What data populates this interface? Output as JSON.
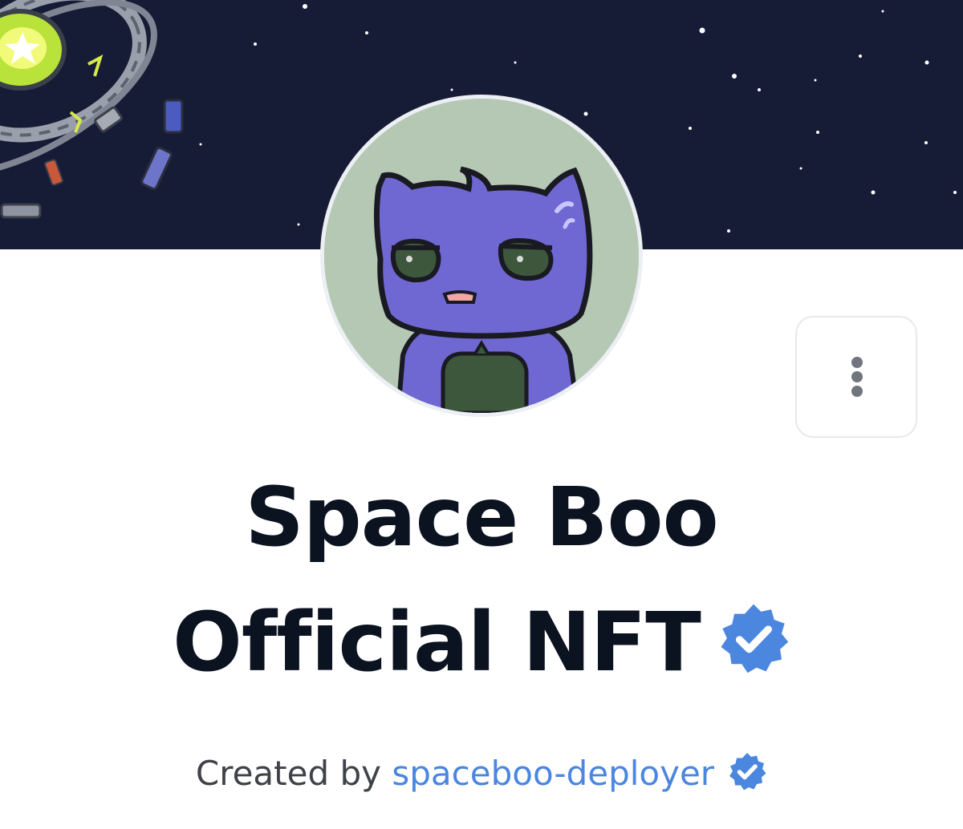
{
  "collection": {
    "title_line_1": "Space Boo",
    "title_line_2": "Official NFT",
    "verified_icon": "verified-badge-icon",
    "accent_color": "#4b86df",
    "title_color": "#0b1220",
    "banner_color": "#161c36"
  },
  "creator": {
    "prefix": "Created by",
    "username": "spaceboo-deployer",
    "verified_icon": "verified-badge-icon"
  },
  "actions": {
    "more_icon": "more-vertical-icon"
  },
  "avatar": {
    "image": "purple-cat-avatar"
  }
}
